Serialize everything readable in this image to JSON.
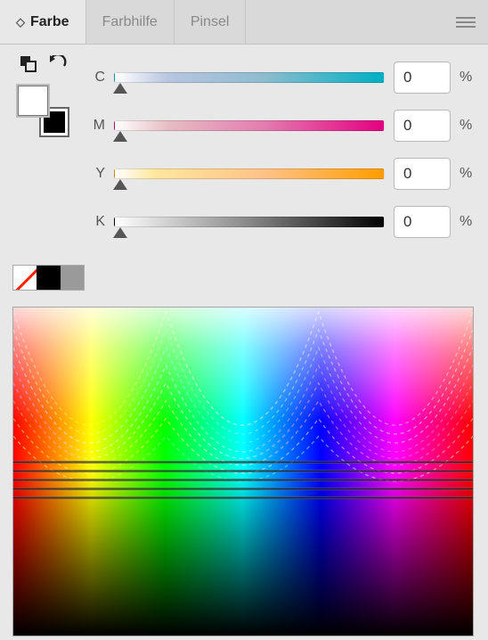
{
  "tabs": {
    "color": "Farbe",
    "guide": "Farbhilfe",
    "brush": "Pinsel"
  },
  "channels": {
    "c": {
      "label": "C",
      "value": "0"
    },
    "m": {
      "label": "M",
      "value": "0"
    },
    "y": {
      "label": "Y",
      "value": "0"
    },
    "k": {
      "label": "K",
      "value": "0"
    }
  },
  "percent_symbol": "%",
  "swatches": {
    "none": "none-swatch",
    "black": "black-swatch",
    "gray": "gray-swatch"
  }
}
